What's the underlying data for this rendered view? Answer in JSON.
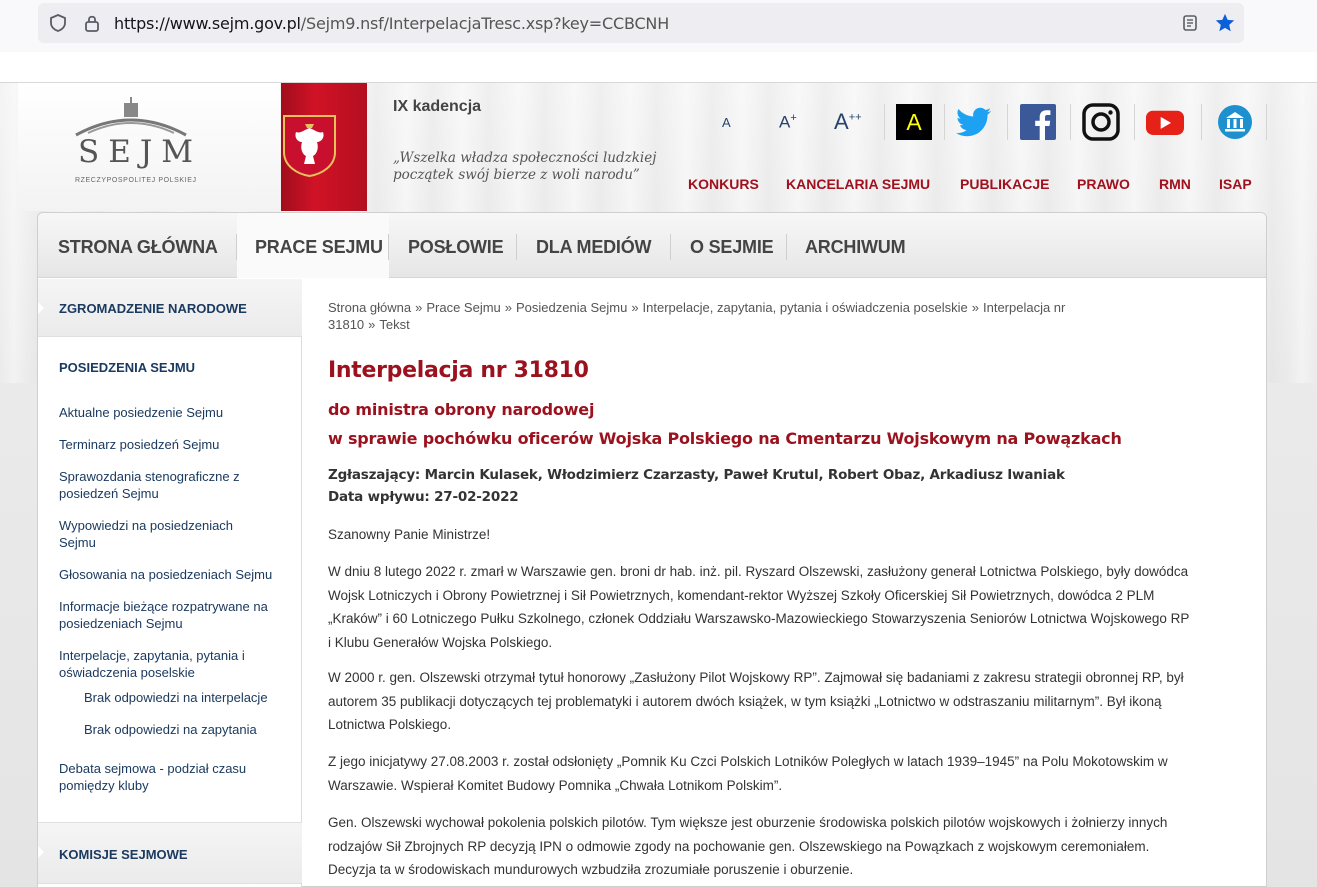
{
  "browser": {
    "url_host": "https://www.sejm.gov.pl",
    "url_path": "/Sejm9.nsf/InterpelacjaTresc.xsp?key=CCBCNH"
  },
  "header": {
    "logo_text": "SEJM",
    "logo_subtitle": "RZECZYPOSPOLITEJ POLSKIEJ",
    "kadencja": "IX kadencja",
    "motto_line1": "„Wszelka władza społeczności ludzkiej",
    "motto_line2": "początek swój bierze z woli narodu”",
    "font_small": "A",
    "font_mid": "A",
    "font_mid_sup": "+",
    "font_big": "A",
    "font_big_sup": "++",
    "contrast": "A",
    "top_links": [
      "KONKURS",
      "KANCELARIA SEJMU",
      "PUBLIKACJE",
      "PRAWO",
      "RMN",
      "ISAP"
    ]
  },
  "nav": {
    "items": [
      "STRONA GŁÓWNA",
      "PRACE SEJMU",
      "POSŁOWIE",
      "DLA MEDIÓW",
      "O SEJMIE",
      "ARCHIWUM"
    ],
    "active_index": 1
  },
  "sidebar": {
    "head1": "ZGROMADZENIE NARODOWE",
    "section_title": "POSIEDZENIA SEJMU",
    "links": [
      "Aktualne posiedzenie Sejmu",
      "Terminarz posiedzeń Sejmu",
      "Sprawozdania stenograficzne z posiedzeń Sejmu",
      "Wypowiedzi na posiedzeniach Sejmu",
      "Głosowania na posiedzeniach Sejmu",
      "Informacje bieżące rozpatrywane na posiedzeniach Sejmu",
      "Interpelacje, zapytania, pytania i oświadczenia poselskie"
    ],
    "sublinks": [
      "Brak odpowiedzi na interpelacje",
      "Brak odpowiedzi na zapytania"
    ],
    "link_last": "Debata sejmowa - podział czasu pomiędzy kluby",
    "head2": "KOMISJE SEJMOWE"
  },
  "breadcrumb": {
    "items": [
      "Strona główna",
      "Prace Sejmu",
      "Posiedzenia Sejmu",
      "Interpelacje, zapytania, pytania i oświadczenia poselskie",
      "Interpelacja nr 31810",
      "Tekst"
    ],
    "separator": "»"
  },
  "content": {
    "title": "Interpelacja nr 31810",
    "subtitle1": "do ministra obrony narodowej",
    "subtitle2": "w sprawie pochówku oficerów Wojska Polskiego na Cmentarzu Wojskowym na Powązkach",
    "authors": "Zgłaszający: Marcin Kulasek, Włodzimierz Czarzasty, Paweł Krutul, Robert Obaz, Arkadiusz Iwaniak",
    "date": "Data wpływu: 27-02-2022",
    "salutation": "Szanowny Panie Ministrze!",
    "paragraphs": [
      "W dniu 8 lutego 2022 r. zmarł w Warszawie gen. broni dr hab. inż. pil. Ryszard Olszewski, zasłużony generał Lotnictwa Polskiego, były dowódca Wojsk Lotniczych i Obrony Powietrznej i Sił Powietrznych, komendant-rektor Wyższej Szkoły Oficerskiej Sił Powietrznych, dowódca 2 PLM „Kraków” i 60 Lotniczego Pułku Szkolnego, członek Oddziału Warszawsko-Mazowieckiego Stowarzyszenia Seniorów Lotnictwa Wojskowego RP i Klubu Generałów Wojska Polskiego.",
      "W 2000 r. gen. Olszewski otrzymał tytuł honorowy „Zasłużony Pilot Wojskowy RP”. Zajmował się badaniami z zakresu strategii obronnej RP, był autorem 35 publikacji dotyczących tej problematyki i autorem dwóch książek, w tym książki „Lotnictwo w odstraszaniu militarnym”. Był ikoną Lotnictwa Polskiego.",
      "Z jego inicjatywy 27.08.2003 r. został odsłonięty „Pomnik Ku Czci Polskich Lotników Poległych w latach 1939–1945” na Polu Mokotowskim w Warszawie. Wspierał Komitet Budowy Pomnika „Chwała Lotnikom Polskim”.",
      "Gen. Olszewski wychował pokolenia polskich pilotów. Tym większe jest oburzenie środowiska polskich pilotów wojskowych i żołnierzy innych rodzajów Sił Zbrojnych RP decyzją IPN o odmowie zgody na pochowanie gen. Olszewskiego na Powązkach z wojskowym ceremoniałem. Decyzja ta w środowiskach mundurowych wzbudziła zrozumiałe poruszenie i oburzenie."
    ]
  }
}
